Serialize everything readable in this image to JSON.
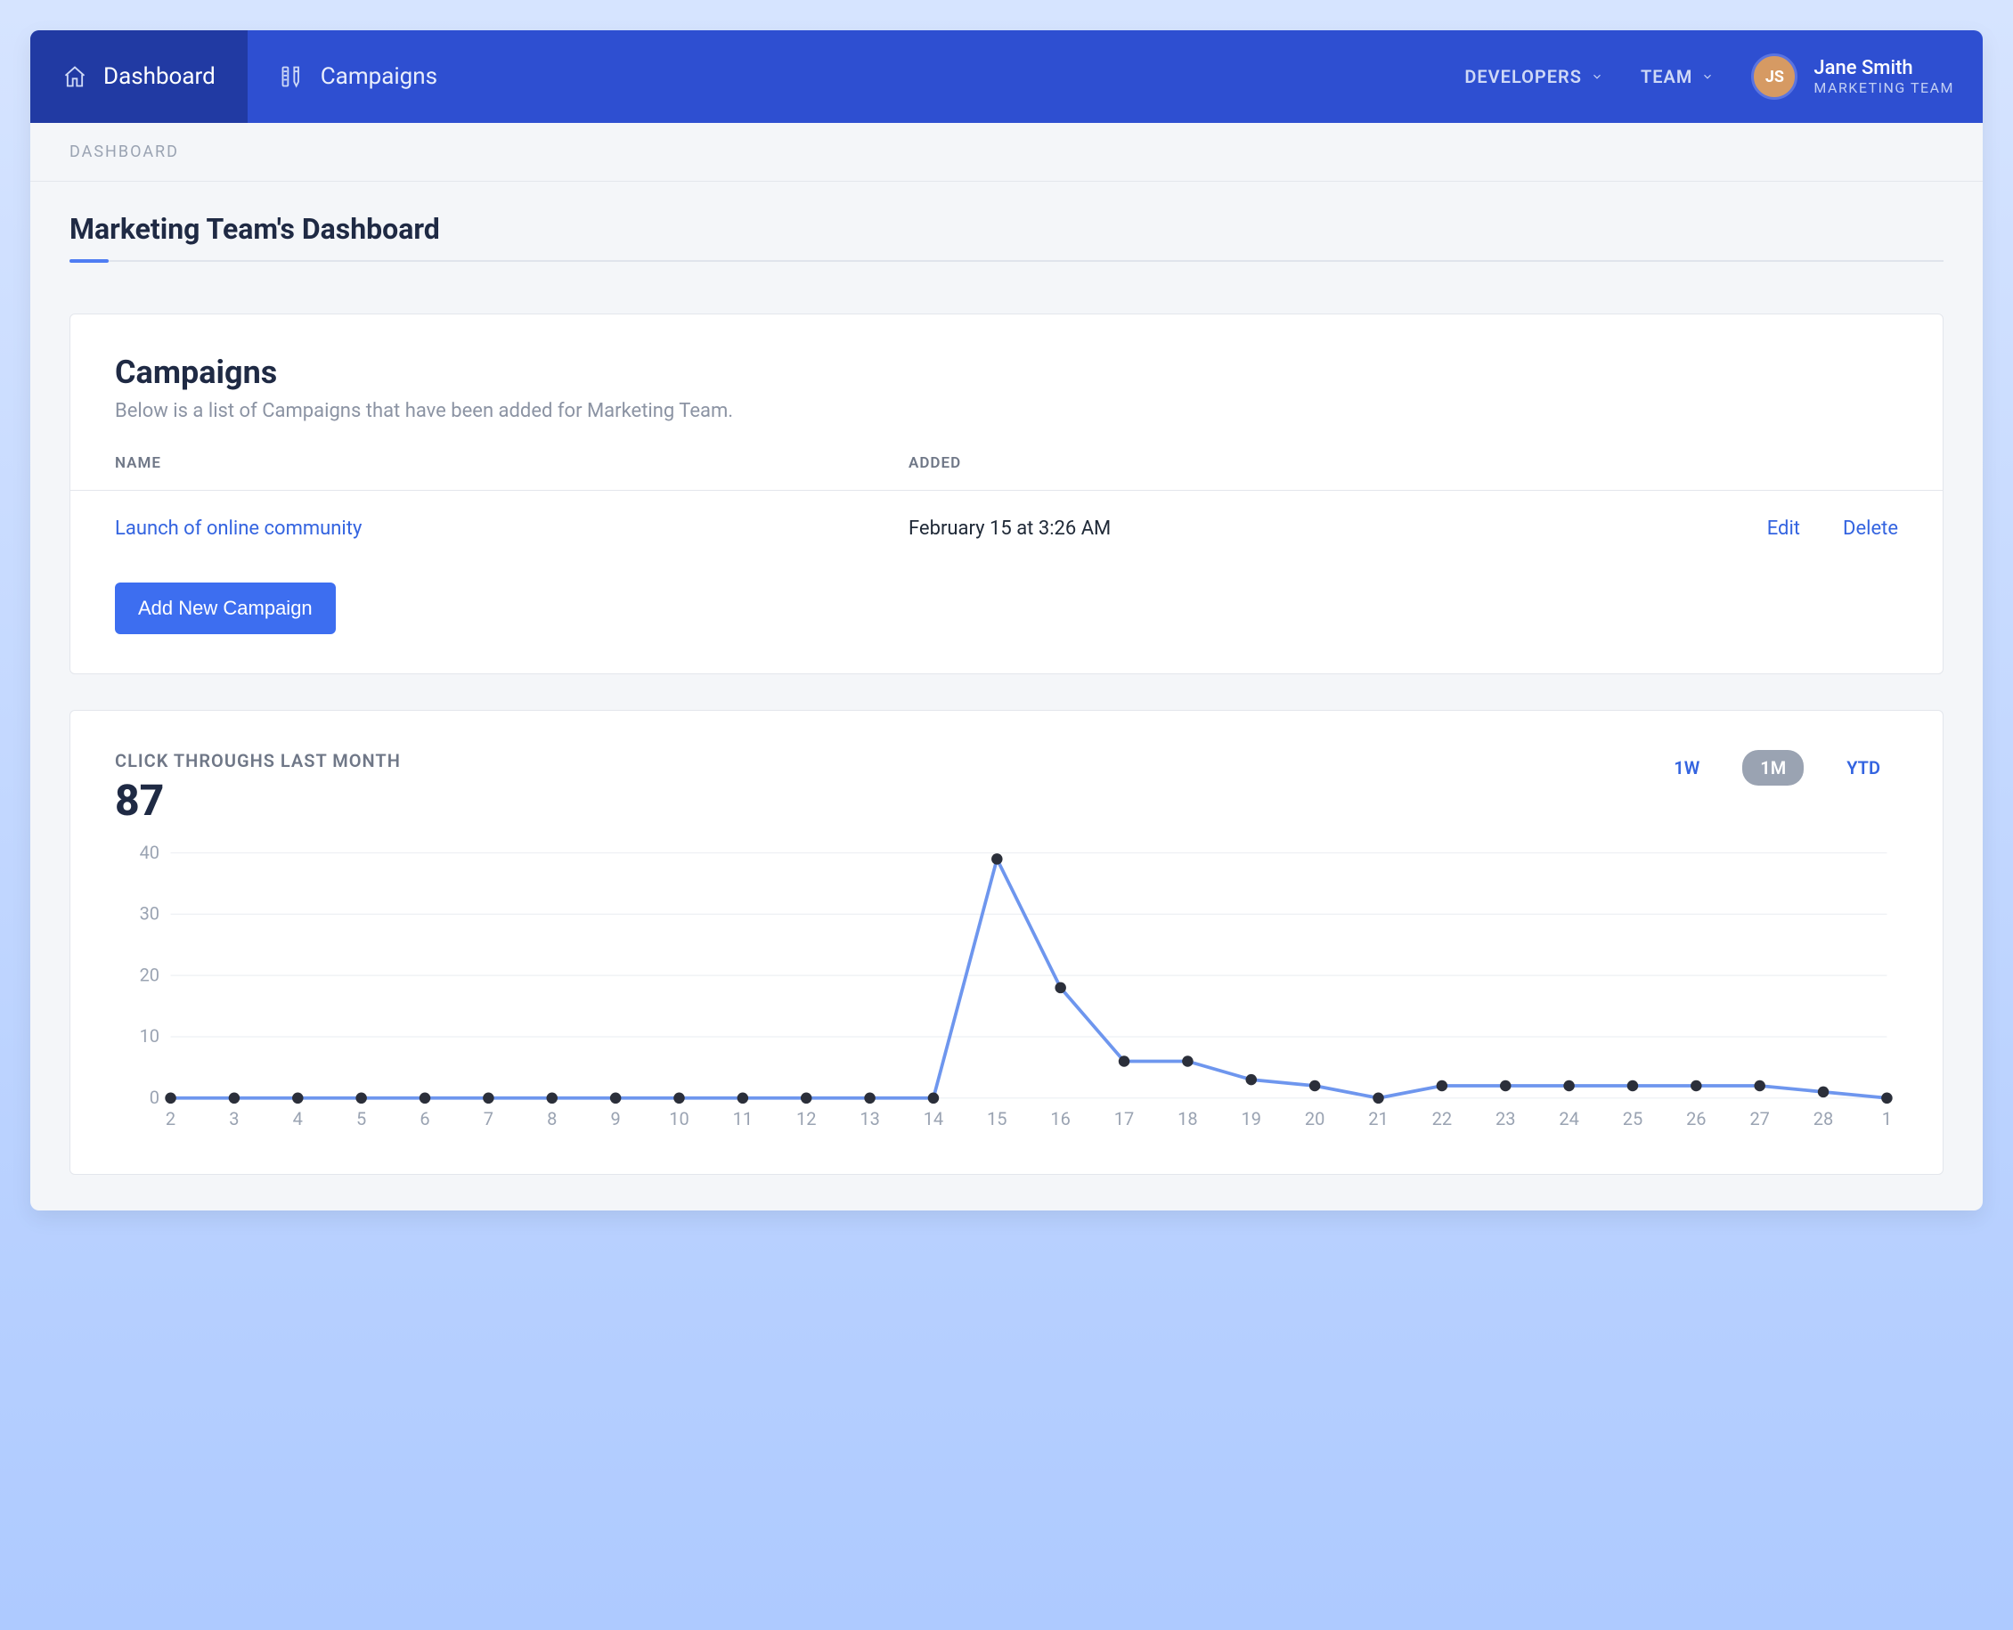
{
  "nav": {
    "items": [
      {
        "label": "Dashboard",
        "icon": "home-icon",
        "active": true
      },
      {
        "label": "Campaigns",
        "icon": "ruler-pencil-icon",
        "active": false
      }
    ],
    "menus": [
      {
        "label": "DEVELOPERS"
      },
      {
        "label": "TEAM"
      }
    ],
    "user": {
      "name": "Jane Smith",
      "role": "MARKETING TEAM",
      "initials": "JS"
    }
  },
  "breadcrumb": "DASHBOARD",
  "page_title": "Marketing Team's Dashboard",
  "campaigns_card": {
    "title": "Campaigns",
    "subtitle": "Below is a list of Campaigns that have been added for Marketing Team.",
    "columns": {
      "name": "NAME",
      "added": "ADDED"
    },
    "rows": [
      {
        "name": "Launch of online community",
        "added": "February 15 at 3:26 AM",
        "edit": "Edit",
        "delete": "Delete"
      }
    ],
    "add_button": "Add New Campaign"
  },
  "chart_card": {
    "label": "CLICK THROUGHS LAST MONTH",
    "total": "87",
    "ranges": [
      {
        "label": "1W",
        "active": false
      },
      {
        "label": "1M",
        "active": true
      },
      {
        "label": "YTD",
        "active": false
      }
    ]
  },
  "chart_data": {
    "type": "line",
    "title": "Click throughs last month",
    "xlabel": "",
    "ylabel": "",
    "ylim": [
      0,
      40
    ],
    "y_ticks": [
      0,
      10,
      20,
      30,
      40
    ],
    "categories": [
      "2",
      "3",
      "4",
      "5",
      "6",
      "7",
      "8",
      "9",
      "10",
      "11",
      "12",
      "13",
      "14",
      "15",
      "16",
      "17",
      "18",
      "19",
      "20",
      "21",
      "22",
      "23",
      "24",
      "25",
      "26",
      "27",
      "28",
      "1"
    ],
    "values": [
      0,
      0,
      0,
      0,
      0,
      0,
      0,
      0,
      0,
      0,
      0,
      0,
      0,
      39,
      18,
      6,
      6,
      3,
      2,
      0,
      2,
      2,
      2,
      2,
      2,
      2,
      1,
      0
    ]
  }
}
